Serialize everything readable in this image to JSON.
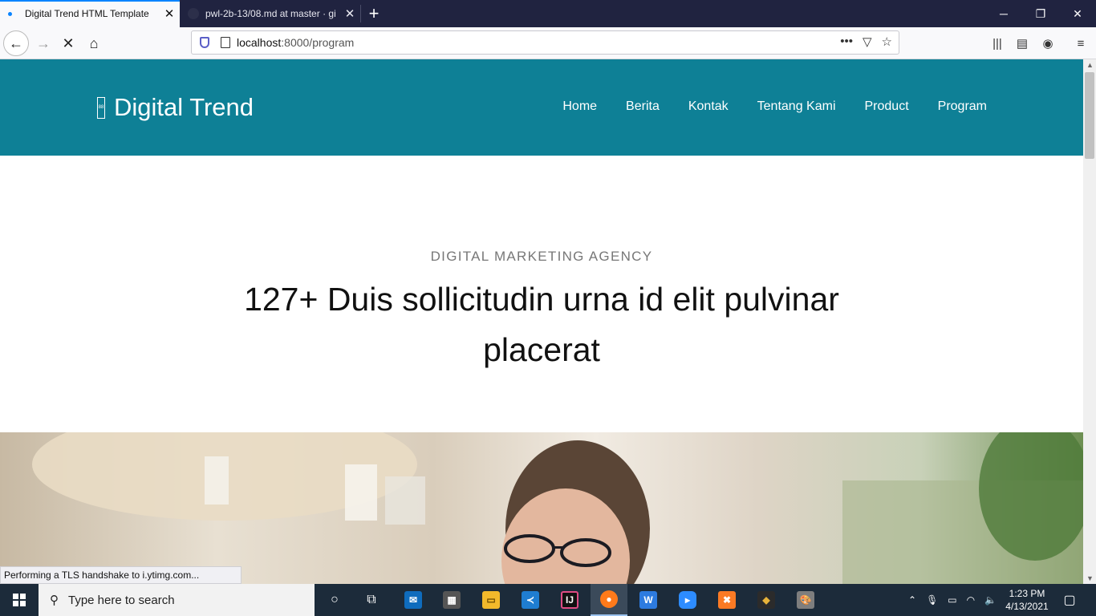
{
  "browser": {
    "tabs": [
      {
        "title": "Digital Trend HTML Template",
        "active": true
      },
      {
        "title": "pwl-2b-13/08.md at master · gi",
        "active": false
      }
    ],
    "url_host": "localhost",
    "url_rest": ":8000/program",
    "status_text": "Performing a TLS handshake to i.ytimg.com..."
  },
  "site": {
    "brand": "Digital Trend",
    "logo_text": "88",
    "nav": [
      "Home",
      "Berita",
      "Kontak",
      "Tentang Kami",
      "Product",
      "Program"
    ]
  },
  "hero": {
    "subtitle": "DIGITAL MARKETING AGENCY",
    "title": "127+ Duis sollicitudin urna id elit pulvinar placerat"
  },
  "taskbar": {
    "search_placeholder": "Type here to search",
    "time": "1:23 PM",
    "date": "4/13/2021"
  },
  "colors": {
    "header_bg": "#0e8096",
    "accent_tab": "#0a84ff"
  }
}
